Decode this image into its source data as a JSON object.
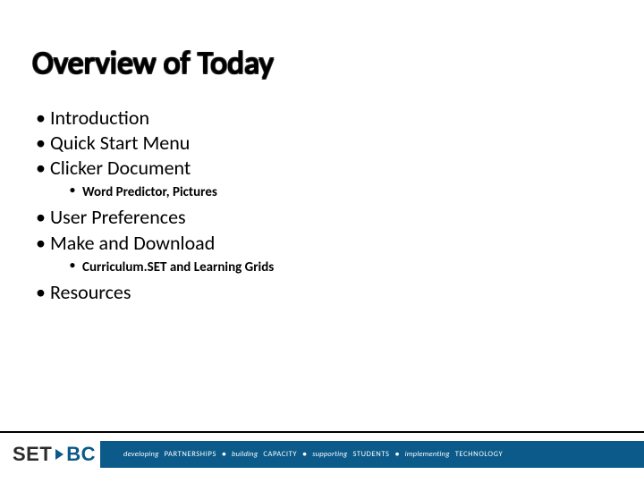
{
  "title": "Overview of Today",
  "bullets": {
    "b1": "Introduction",
    "b2": "Quick Start Menu",
    "b3": "Clicker Document",
    "b3a": "Word Predictor, Pictures",
    "b4": "User Preferences",
    "b5": "Make and Download",
    "b5a": "Curriculum.SET and Learning Grids",
    "b6": "Resources"
  },
  "logo": {
    "set": "SET",
    "bc": "BC"
  },
  "footer": {
    "p1_em": "developing",
    "p1_cap": "PARTNERSHIPS",
    "p2_em": "building",
    "p2_cap": "CAPACITY",
    "p3_em": "supporting",
    "p3_cap": "STUDENTS",
    "p4_em": "implementing",
    "p4_cap": "TECHNOLOGY",
    "dot": "●"
  }
}
